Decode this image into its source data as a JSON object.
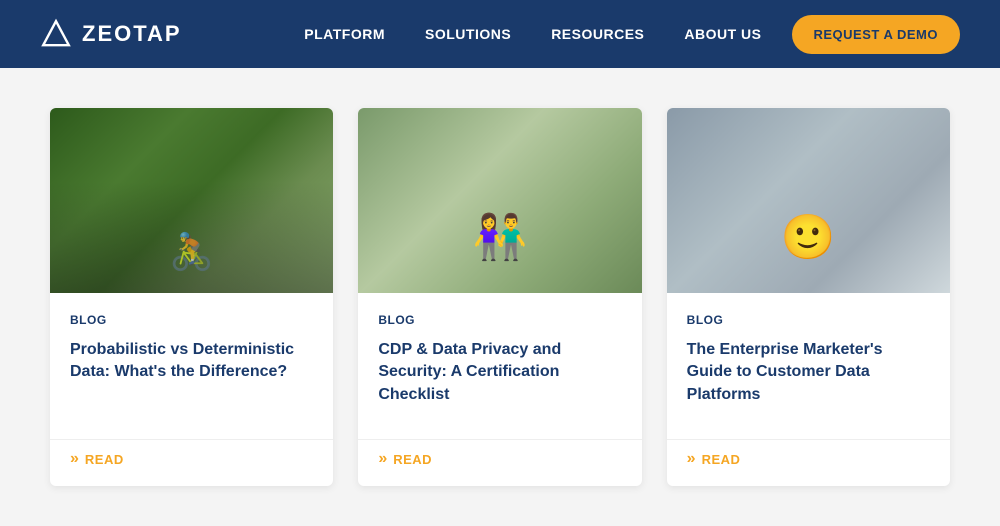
{
  "brand": {
    "logo_text": "ZEOTAP",
    "logo_icon_title": "Zeotap triangle logo"
  },
  "navbar": {
    "links": [
      {
        "label": "PLATFORM",
        "id": "platform"
      },
      {
        "label": "SOLUTIONS",
        "id": "solutions"
      },
      {
        "label": "RESOURCES",
        "id": "resources"
      },
      {
        "label": "ABOUT US",
        "id": "about-us"
      }
    ],
    "cta_label": "REQUEST A DEMO"
  },
  "cards": [
    {
      "tag": "BLOG",
      "title": "Probabilistic vs Deterministic Data: What's the Difference?",
      "read_label": "READ",
      "image_type": "forest-biking"
    },
    {
      "tag": "BLOG",
      "title": "CDP & Data Privacy and Security: A Certification Checklist",
      "read_label": "READ",
      "image_type": "couple-phone"
    },
    {
      "tag": "BLOG",
      "title": "The Enterprise Marketer's Guide to Customer Data Platforms",
      "read_label": "READ",
      "image_type": "woman-city"
    }
  ],
  "colors": {
    "nav_bg": "#1a3a6b",
    "accent": "#f5a623",
    "text_dark": "#1a3a6b"
  }
}
